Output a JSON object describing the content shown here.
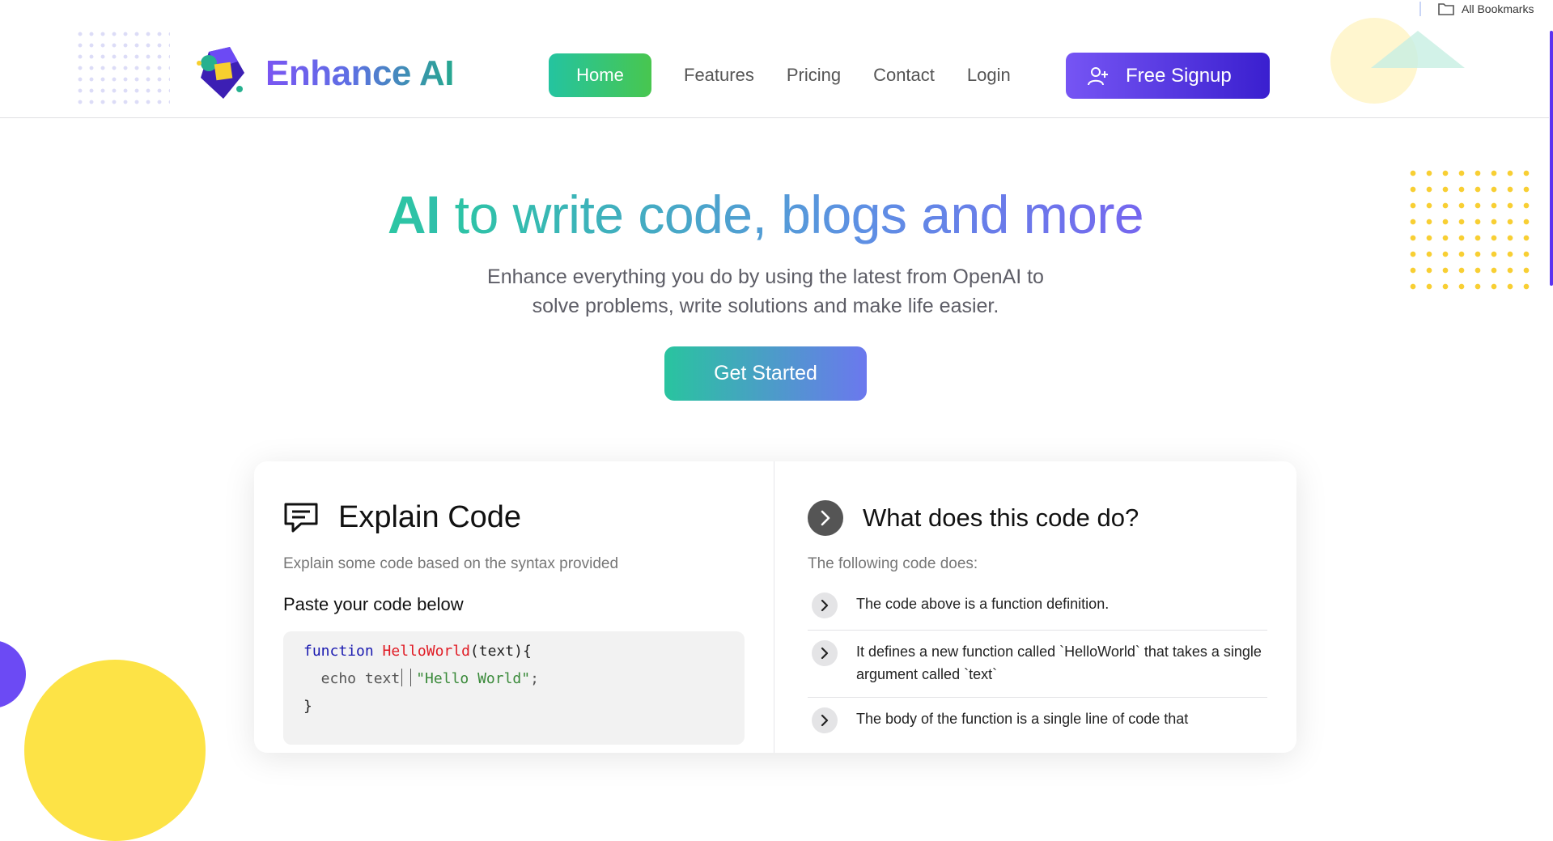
{
  "bookmarks": {
    "label": "All Bookmarks"
  },
  "brand": {
    "name": "Enhance AI"
  },
  "nav": {
    "items": [
      {
        "label": "Home"
      },
      {
        "label": "Features"
      },
      {
        "label": "Pricing"
      },
      {
        "label": "Contact"
      },
      {
        "label": "Login"
      }
    ],
    "signup_label": "Free Signup"
  },
  "hero": {
    "title_ai": "AI",
    "title_rest": " to write code, blogs and more",
    "subtitle_line1": "Enhance everything you do by using the latest from OpenAI to",
    "subtitle_line2": "solve problems, write solutions and make life easier.",
    "cta_label": "Get Started"
  },
  "explain": {
    "title": "Explain Code",
    "description": "Explain some code based on the syntax provided",
    "paste_label": "Paste your code below",
    "code": {
      "line1_kw": "function",
      "line1_fn": "HelloWorld",
      "line1_rest": "(text){",
      "line2_plain": "  echo text",
      "line2_str": "\"Hello World\"",
      "line2_end": ";",
      "line3": "}"
    }
  },
  "answer": {
    "title": "What does this code do?",
    "intro": "The following code does:",
    "items": [
      {
        "text": "The code above is a function definition."
      },
      {
        "text": "It defines a new function called `HelloWorld` that takes a single argument called `text`"
      },
      {
        "text": "The body of the function is a single line of code that"
      }
    ]
  },
  "colors": {
    "primary_purple": "#6c4af4",
    "gradient_teal": "#2bc6a3",
    "gradient_blue": "#6b78ee",
    "home_green": "#48c64f",
    "accent_yellow": "#fde346"
  },
  "icons": {
    "bookmark": "folder-icon",
    "signup": "add-user-icon",
    "explain": "chat-bubble-icon",
    "answer": "chevron-right-icon"
  }
}
